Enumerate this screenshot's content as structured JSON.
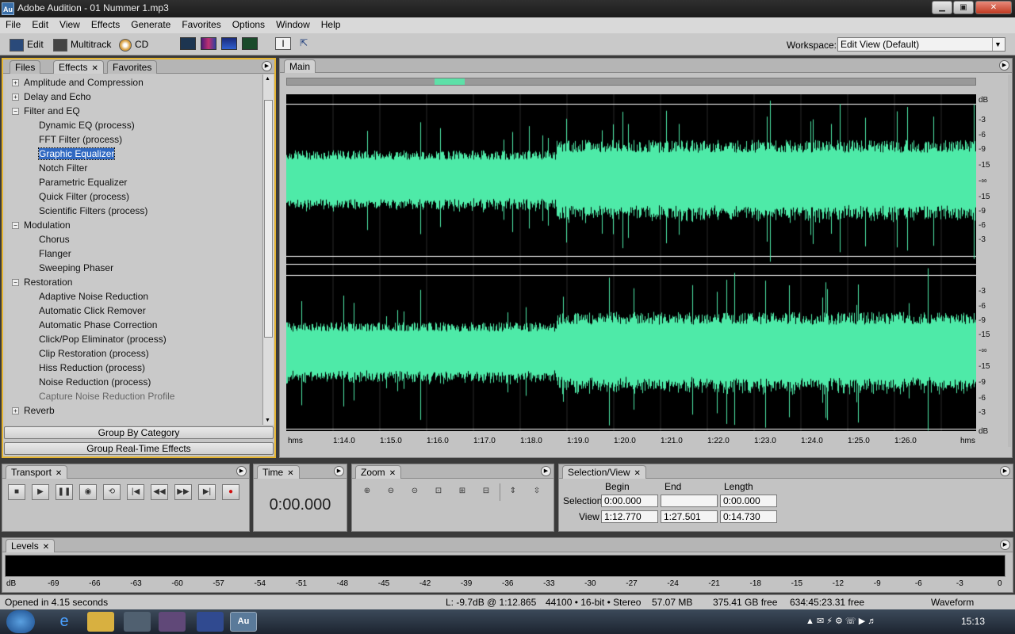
{
  "window": {
    "app_icon": "Au",
    "title": "Adobe Audition - 01 Nummer 1.mp3",
    "minimize": "▁",
    "maximize": "▣",
    "close": "✕"
  },
  "menu": [
    "File",
    "Edit",
    "View",
    "Effects",
    "Generate",
    "Favorites",
    "Options",
    "Window",
    "Help"
  ],
  "toolbar": {
    "edit_label": "Edit",
    "multitrack_label": "Multitrack",
    "cd_label": "CD",
    "workspace_label": "Workspace:",
    "workspace_value": "Edit View (Default)"
  },
  "left_panel": {
    "tabs": [
      "Files",
      "Effects",
      "Favorites"
    ],
    "tree": [
      {
        "label": "Amplitude and Compression",
        "level": 0,
        "expander": "+"
      },
      {
        "label": "Delay and Echo",
        "level": 0,
        "expander": "+"
      },
      {
        "label": "Filter and EQ",
        "level": 0,
        "expander": "−"
      },
      {
        "label": "Dynamic EQ (process)",
        "level": 1
      },
      {
        "label": "FFT Filter (process)",
        "level": 1
      },
      {
        "label": "Graphic Equalizer",
        "level": 1,
        "selected": true
      },
      {
        "label": "Notch Filter",
        "level": 1
      },
      {
        "label": "Parametric Equalizer",
        "level": 1
      },
      {
        "label": "Quick Filter (process)",
        "level": 1
      },
      {
        "label": "Scientific Filters (process)",
        "level": 1
      },
      {
        "label": "Modulation",
        "level": 0,
        "expander": "−"
      },
      {
        "label": "Chorus",
        "level": 1
      },
      {
        "label": "Flanger",
        "level": 1
      },
      {
        "label": "Sweeping Phaser",
        "level": 1
      },
      {
        "label": "Restoration",
        "level": 0,
        "expander": "−"
      },
      {
        "label": "Adaptive Noise Reduction",
        "level": 1
      },
      {
        "label": "Automatic Click Remover",
        "level": 1
      },
      {
        "label": "Automatic Phase Correction",
        "level": 1
      },
      {
        "label": "Click/Pop Eliminator (process)",
        "level": 1
      },
      {
        "label": "Clip Restoration (process)",
        "level": 1
      },
      {
        "label": "Hiss Reduction (process)",
        "level": 1
      },
      {
        "label": "Noise Reduction (process)",
        "level": 1
      },
      {
        "label": "Capture Noise Reduction Profile",
        "level": 1,
        "disabled": true
      },
      {
        "label": "Reverb",
        "level": 0,
        "expander": "+"
      }
    ],
    "group_by_category": "Group By Category",
    "group_realtime": "Group Real-Time Effects"
  },
  "main_panel": {
    "tab": "Main",
    "db_labels_top": [
      "dB",
      "-3",
      "-6",
      "-9",
      "-15",
      "-∞",
      "-15",
      "-9",
      "-6",
      "-3"
    ],
    "db_labels_bottom": [
      "-3",
      "-6",
      "-9",
      "-15",
      "-∞",
      "-15",
      "-9",
      "-6",
      "-3",
      "dB"
    ],
    "time_labels": [
      "hms",
      "1:14.0",
      "1:15.0",
      "1:16.0",
      "1:17.0",
      "1:18.0",
      "1:19.0",
      "1:20.0",
      "1:21.0",
      "1:22.0",
      "1:23.0",
      "1:24.0",
      "1:25.0",
      "1:26.0",
      "hms"
    ],
    "wave_color": "#4eeaa8"
  },
  "transport": {
    "title": "Transport"
  },
  "time_panel": {
    "title": "Time",
    "value": "0:00.000"
  },
  "zoom_panel": {
    "title": "Zoom"
  },
  "selection_view": {
    "title": "Selection/View",
    "col_begin": "Begin",
    "col_end": "End",
    "col_length": "Length",
    "row_selection": "Selection",
    "row_view": "View",
    "sel_begin": "0:00.000",
    "sel_end": "",
    "sel_length": "0:00.000",
    "view_begin": "1:12.770",
    "view_end": "1:27.501",
    "view_length": "0:14.730"
  },
  "levels": {
    "title": "Levels",
    "scale": [
      "dB",
      "-69",
      "-66",
      "-63",
      "-60",
      "-57",
      "-54",
      "-51",
      "-48",
      "-45",
      "-42",
      "-39",
      "-36",
      "-33",
      "-30",
      "-27",
      "-24",
      "-21",
      "-18",
      "-15",
      "-12",
      "-9",
      "-6",
      "-3",
      "0"
    ]
  },
  "status": {
    "opened": "Opened in 4.15 seconds",
    "level": "L: -9.7dB @   1:12.865",
    "format": "44100 • 16-bit • Stereo",
    "size": "57.07 MB",
    "free": "375.41 GB free",
    "free_time": "634:45:23.31 free",
    "view": "Waveform"
  },
  "taskbar": {
    "clock": "15:13"
  }
}
